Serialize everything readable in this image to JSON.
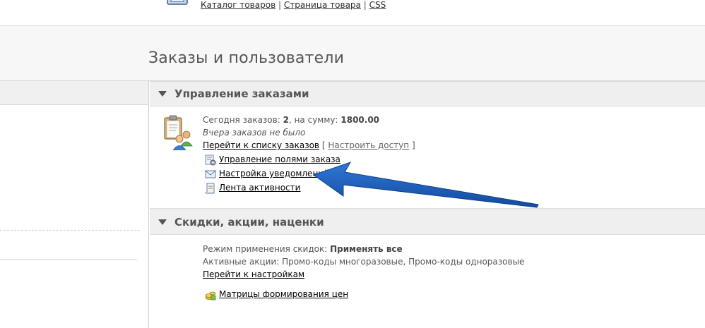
{
  "top": {
    "links": [
      "Каталог товаров",
      "Страница товара",
      "CSS"
    ],
    "separator": "|"
  },
  "page_title": "Заказы и пользователи",
  "orders_panel": {
    "title": "Управление заказами",
    "today_label": "Сегодня заказов:",
    "today_count": "2",
    "sum_label": ", на сумму:",
    "sum_value": "1800.00",
    "yesterday": "Вчера заказов не было",
    "goto_orders": "Перейти к списку заказов",
    "access_open": "[",
    "access_link": "Настроить доступ",
    "access_close": "]",
    "links": [
      {
        "label": "Управление полями заказа",
        "icon": "fields-gear-icon"
      },
      {
        "label": "Настройка уведомлений",
        "icon": "envelope-icon"
      },
      {
        "label": "Лента активности",
        "icon": "scroll-icon"
      }
    ]
  },
  "discounts_panel": {
    "title": "Скидки, акции, наценки",
    "mode_label": "Режим применения скидок:",
    "mode_value": "Применять все",
    "active_label": "Активные акции:",
    "active_value": "Промо-коды многоразовые, Промо-коды одноразовые",
    "goto_settings": "Перейти к настройкам",
    "matrix_link": "Матрицы формирования цен",
    "matrix_icon": "coins-icon"
  },
  "colors": {
    "arrow": "#1f5fbf",
    "header_bg": "#f7f7f7",
    "panel_head_bg": "#efefef"
  }
}
